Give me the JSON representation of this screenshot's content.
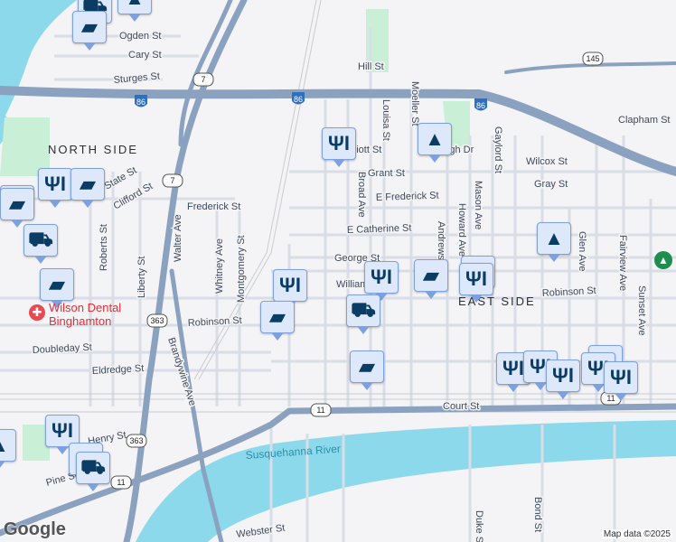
{
  "map": {
    "areas": [
      "NORTH SIDE",
      "EAST SIDE"
    ],
    "river": "Susquehanna River",
    "streets": [
      "Ogden St",
      "Cary St",
      "Sturges St",
      "State St",
      "Clifford St",
      "Frederick St",
      "Roberts St",
      "Liberty St",
      "Walter Ave",
      "Whitney Ave",
      "Montgomery St",
      "Robinson St",
      "Doubleday St",
      "Eldredge St",
      "Brandywine Ave",
      "Henry St",
      "Pine St",
      "Webster St",
      "Court St",
      "Broad Ave",
      "Louisa St",
      "Moeller St",
      "Grant St",
      "E Frederick St",
      "E Catherine St",
      "George St",
      "William St",
      "Andrews St",
      "Howard Ave",
      "Mason Ave",
      "Gaylord St",
      "Wilcox St",
      "Gray St",
      "Clapham St",
      "Glen Ave",
      "Fairview Ave",
      "Sunset Ave",
      "Robinson St",
      "Hill St",
      "Bond St",
      "Duke St",
      "High Dr",
      "Elliott St"
    ],
    "shields": [
      "86",
      "86",
      "86",
      "7",
      "7",
      "363",
      "363",
      "11",
      "11",
      "11",
      "145"
    ],
    "markers": [
      "shopping-cart",
      "school",
      "shopping-bag",
      "restaurant",
      "shopping-bag",
      "restaurant",
      "shopping-bag",
      "shopping-cart",
      "shopping-bag",
      "restaurant",
      "restaurant",
      "shopping-bag",
      "restaurant",
      "shopping-cart",
      "shopping-bag",
      "school",
      "shopping-bag",
      "restaurant",
      "school",
      "restaurant",
      "restaurant",
      "restaurant",
      "restaurant",
      "restaurant",
      "restaurant",
      "restaurant",
      "restaurant",
      "school",
      "shopping-bag",
      "shopping-cart"
    ],
    "poi": {
      "name": "Wilson Dental Binghamton",
      "color": "#e0303a"
    },
    "attribution": "Map data ©2025",
    "logo": "Google"
  }
}
